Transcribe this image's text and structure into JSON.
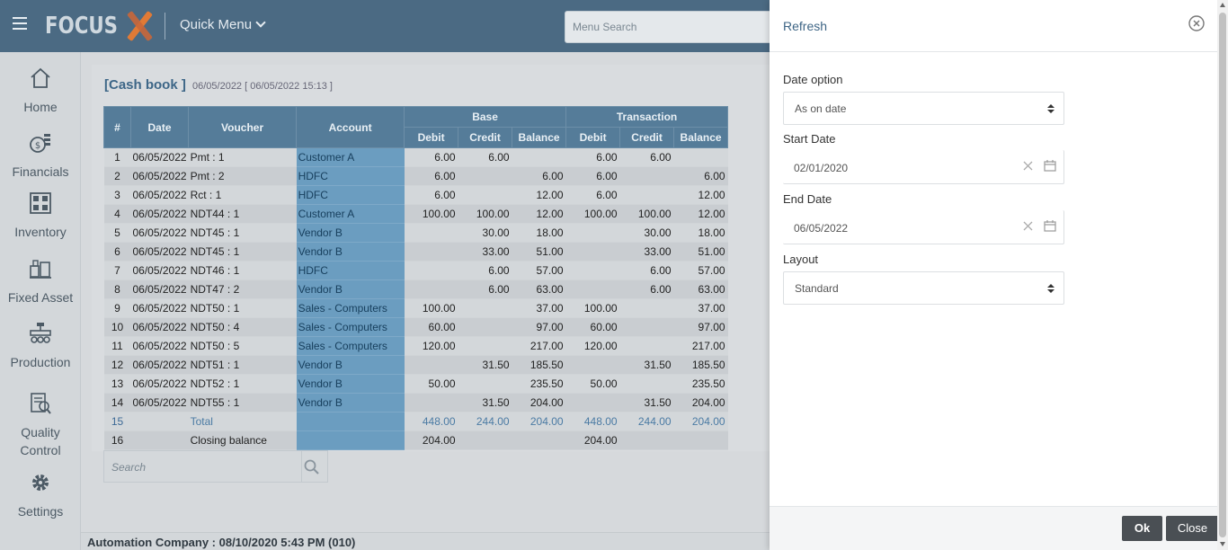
{
  "topbar": {
    "logo_text": "FOCUS",
    "quick_menu_label": "Quick Menu",
    "menu_search_placeholder": "Menu Search"
  },
  "sidebar": {
    "items": [
      {
        "label": "Home",
        "icon": "home-icon"
      },
      {
        "label": "Financials",
        "icon": "financials-icon"
      },
      {
        "label": "Inventory",
        "icon": "inventory-icon"
      },
      {
        "label": "Fixed Asset",
        "icon": "fixed-asset-icon"
      },
      {
        "label": "Production",
        "icon": "production-icon"
      },
      {
        "label": "Quality Control",
        "icon": "quality-control-icon"
      },
      {
        "label": "Settings",
        "icon": "settings-icon"
      }
    ]
  },
  "report": {
    "title": "[Cash book ]",
    "subtitle": "06/05/2022 [ 06/05/2022 15:13 ]",
    "headers": {
      "idx": "#",
      "date": "Date",
      "voucher": "Voucher",
      "account": "Account",
      "base": "Base",
      "transaction": "Transaction",
      "debit": "Debit",
      "credit": "Credit",
      "balance": "Balance"
    },
    "rows": [
      [
        "1",
        "06/05/2022",
        "Pmt : 1",
        "Customer A",
        "6.00",
        "6.00",
        "",
        "6.00",
        "6.00",
        ""
      ],
      [
        "2",
        "06/05/2022",
        "Pmt : 2",
        "HDFC",
        "6.00",
        "",
        "6.00",
        "6.00",
        "",
        "6.00"
      ],
      [
        "3",
        "06/05/2022",
        "Rct : 1",
        "HDFC",
        "6.00",
        "",
        "12.00",
        "6.00",
        "",
        "12.00"
      ],
      [
        "4",
        "06/05/2022",
        "NDT44 : 1",
        "Customer A",
        "100.00",
        "100.00",
        "12.00",
        "100.00",
        "100.00",
        "12.00"
      ],
      [
        "5",
        "06/05/2022",
        "NDT45 : 1",
        "Vendor B",
        "",
        "30.00",
        "18.00",
        "",
        "30.00",
        "18.00"
      ],
      [
        "6",
        "06/05/2022",
        "NDT45 : 1",
        "Vendor B",
        "",
        "33.00",
        "51.00",
        "",
        "33.00",
        "51.00"
      ],
      [
        "7",
        "06/05/2022",
        "NDT46 : 1",
        "HDFC",
        "",
        "6.00",
        "57.00",
        "",
        "6.00",
        "57.00"
      ],
      [
        "8",
        "06/05/2022",
        "NDT47 : 2",
        "Vendor B",
        "",
        "6.00",
        "63.00",
        "",
        "6.00",
        "63.00"
      ],
      [
        "9",
        "06/05/2022",
        "NDT50 : 1",
        "Sales - Computers",
        "100.00",
        "",
        "37.00",
        "100.00",
        "",
        "37.00"
      ],
      [
        "10",
        "06/05/2022",
        "NDT50 : 4",
        "Sales - Computers",
        "60.00",
        "",
        "97.00",
        "60.00",
        "",
        "97.00"
      ],
      [
        "11",
        "06/05/2022",
        "NDT50 : 5",
        "Sales - Computers",
        "120.00",
        "",
        "217.00",
        "120.00",
        "",
        "217.00"
      ],
      [
        "12",
        "06/05/2022",
        "NDT51 : 1",
        "Vendor B",
        "",
        "31.50",
        "185.50",
        "",
        "31.50",
        "185.50"
      ],
      [
        "13",
        "06/05/2022",
        "NDT52 : 1",
        "Vendor B",
        "50.00",
        "",
        "235.50",
        "50.00",
        "",
        "235.50"
      ],
      [
        "14",
        "06/05/2022",
        "NDT55 : 1",
        "Vendor B",
        "",
        "31.50",
        "204.00",
        "",
        "31.50",
        "204.00"
      ]
    ],
    "total_row": [
      "15",
      "",
      "Total",
      "",
      "448.00",
      "244.00",
      "204.00",
      "448.00",
      "244.00",
      "204.00"
    ],
    "closing_row": [
      "16",
      "",
      "Closing balance",
      "",
      "204.00",
      "",
      "",
      "204.00",
      "",
      ""
    ],
    "search_placeholder": "Search"
  },
  "status": {
    "text": "Automation Company : 08/10/2020 5:43 PM (010)"
  },
  "dialog": {
    "title": "Refresh",
    "date_option_label": "Date option",
    "date_option_value": "As on date",
    "start_date_label": "Start Date",
    "start_date_value": "02/01/2020",
    "end_date_label": "End Date",
    "end_date_value": "06/05/2022",
    "layout_label": "Layout",
    "layout_value": "Standard",
    "ok_label": "Ok",
    "close_label": "Close"
  }
}
